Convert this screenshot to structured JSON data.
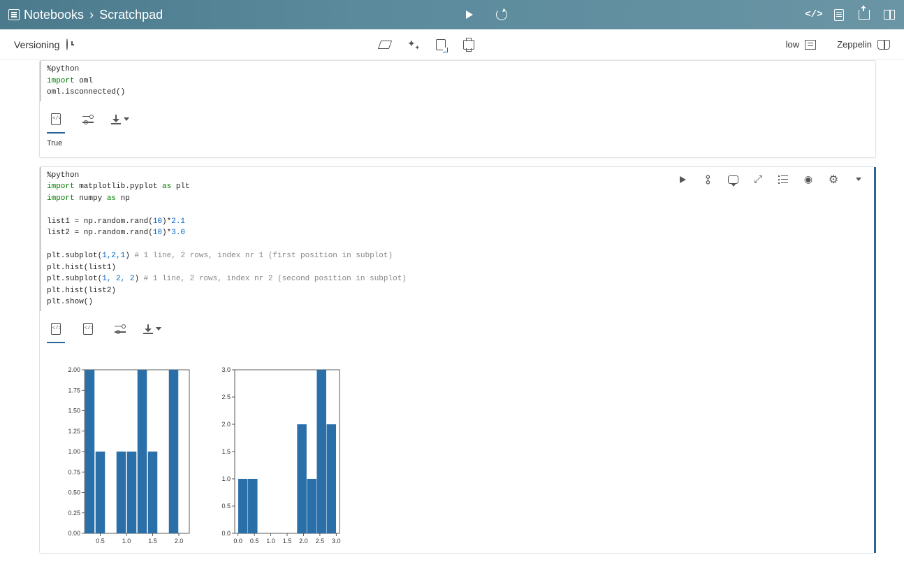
{
  "topbar": {
    "breadcrumb_root": "Notebooks",
    "breadcrumb_sep": "›",
    "breadcrumb_current": "Scratchpad"
  },
  "subbar": {
    "versioning": "Versioning",
    "priority": "low",
    "interpreter": "Zeppelin"
  },
  "cell1": {
    "code_line1": "%python",
    "code_line2a": "import",
    "code_line2b": " oml",
    "code_line3": "oml.isconnected()",
    "output": "True"
  },
  "cell2": {
    "l1": "%python",
    "l2a": "import",
    "l2b": " matplotlib.pyplot ",
    "l2c": "as",
    "l2d": " plt",
    "l3a": "import",
    "l3b": " numpy ",
    "l3c": "as",
    "l3d": " np",
    "l5a": "list1 = np.random.rand(",
    "l5n": "10",
    "l5b": ")*",
    "l5n2": "2.1",
    "l6a": "list2 = np.random.rand(",
    "l6n": "10",
    "l6b": ")*",
    "l6n2": "3.0",
    "l8a": "plt.subplot(",
    "l8n": "1,2,1",
    "l8b": ") ",
    "l8c": "# 1 line, 2 rows, index nr 1 (first position in subplot)",
    "l9": "plt.hist(list1)",
    "l10a": "plt.subplot(",
    "l10n": "1, 2, 2",
    "l10b": ") ",
    "l10c": "# 1 line, 2 rows, index nr 2 (second position in subplot)",
    "l11": "plt.hist(list2)",
    "l12": "plt.show()"
  },
  "chart_data": [
    {
      "type": "bar",
      "categories": [
        "0.5",
        "1.0",
        "1.5",
        "2.0"
      ],
      "bins": [
        0.3,
        0.5,
        0.7,
        0.9,
        1.1,
        1.3,
        1.5,
        1.7,
        1.9,
        2.1
      ],
      "values": [
        2.0,
        1.0,
        0.0,
        1.0,
        1.0,
        2.0,
        1.0,
        0.0,
        2.0,
        0.0
      ],
      "ylim": [
        0.0,
        2.0
      ],
      "yticks": [
        "0.00",
        "0.25",
        "0.50",
        "0.75",
        "1.00",
        "1.25",
        "1.50",
        "1.75",
        "2.00"
      ],
      "xticks": [
        "0.5",
        "1.0",
        "1.5",
        "2.0"
      ]
    },
    {
      "type": "bar",
      "categories": [
        "0.0",
        "0.5",
        "1.0",
        "1.5",
        "2.0",
        "2.5",
        "3.0"
      ],
      "bins": [
        0.15,
        0.45,
        0.75,
        1.05,
        1.35,
        1.65,
        1.95,
        2.25,
        2.55,
        2.85
      ],
      "values": [
        1.0,
        1.0,
        0.0,
        0.0,
        0.0,
        0.0,
        2.0,
        1.0,
        3.0,
        2.0
      ],
      "ylim": [
        0.0,
        3.0
      ],
      "yticks": [
        "0.0",
        "0.5",
        "1.0",
        "1.5",
        "2.0",
        "2.5",
        "3.0"
      ],
      "xticks": [
        "0.0",
        "0.5",
        "1.0",
        "1.5",
        "2.0",
        "2.5",
        "3.0"
      ]
    }
  ]
}
